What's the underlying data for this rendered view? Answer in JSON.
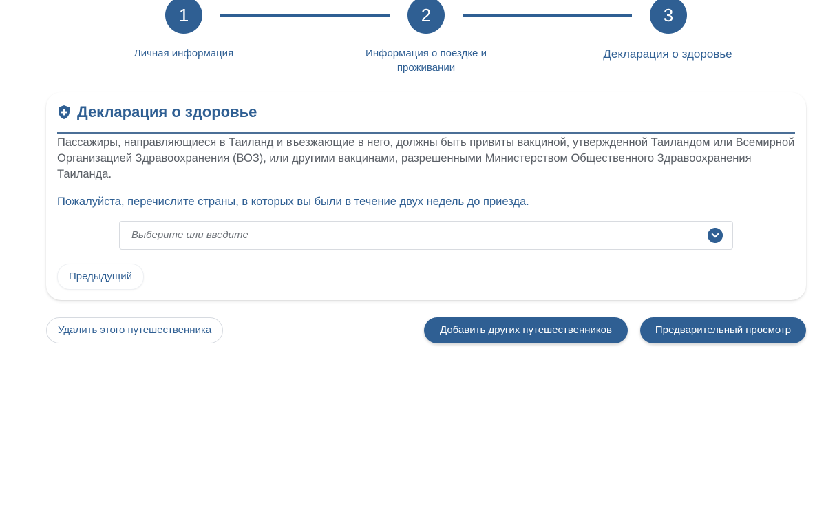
{
  "stepper": {
    "steps": [
      {
        "number": "1",
        "label": "Личная информация"
      },
      {
        "number": "2",
        "label_line1": "Информация о поездке и",
        "label_line2": "проживании"
      },
      {
        "number": "3",
        "label": "Декларация о здоровье"
      }
    ]
  },
  "health": {
    "title": "Декларация о здоровье",
    "icon": "shield-plus-icon",
    "description": "Пассажиры, направляющиеся в Таиланд и въезжающие в него, должны быть привиты вакциной, утвержденной Таиландом или Всемирной Организацией Здравоохранения (ВОЗ), или другими вакцинами, разрешенными Министерством Общественного Здравоохранения Таиланда.",
    "question": "Пожалуйста, перечислите страны, в которых вы были в течение двух недель до приезда.",
    "select_placeholder": "Выберите или введите",
    "prev_button": "Предыдущий"
  },
  "actions": {
    "delete_traveler": "Удалить этого путешественника",
    "add_travelers": "Добавить других путешественников",
    "preview": "Предварительный просмотр"
  },
  "colors": {
    "primary": "#2f5f93",
    "text_muted": "#5a5f66",
    "border": "#d8dbe0"
  }
}
